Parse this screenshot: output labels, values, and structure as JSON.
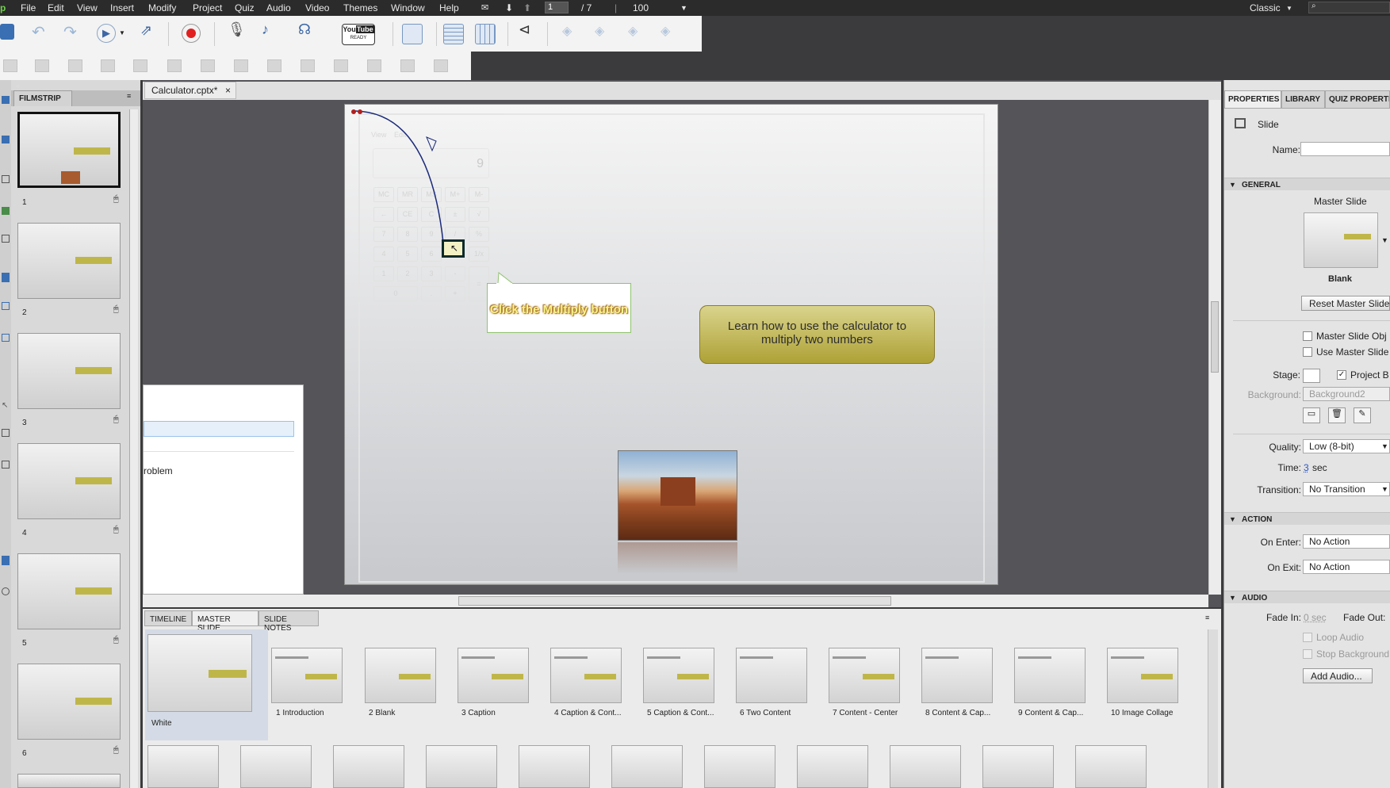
{
  "menubar": {
    "items": [
      "File",
      "Edit",
      "View",
      "Insert",
      "Modify",
      "Project",
      "Quiz",
      "Audio",
      "Video",
      "Themes",
      "Window",
      "Help"
    ],
    "current_slide": "1",
    "total_slides": "/ 7",
    "zoom": "100",
    "workspace": "Classic"
  },
  "toolbar": {
    "youtube_line1": "You",
    "youtube_line2": "Tube",
    "youtube_line3": "READY"
  },
  "filmstrip": {
    "title": "FILMSTRIP",
    "slides": [
      "1",
      "2",
      "3",
      "4",
      "5",
      "6"
    ]
  },
  "document": {
    "tab_title": "Calculator.cptx*",
    "tab_close": "×"
  },
  "slide": {
    "calc_menu_view": "View",
    "calc_menu_edit": "Edit",
    "calc_display": "9",
    "caption_text": "Click the Multiply button",
    "learn_text_line1": "Learn how to use the calculator to",
    "learn_text_line2": "multiply two numbers",
    "overlay_text": "roblem"
  },
  "bottom_panel": {
    "tabs": [
      "TIMELINE",
      "MASTER SLIDE",
      "SLIDE NOTES"
    ],
    "master_main_label": "White",
    "masters": [
      "1 Introduction",
      "2 Blank",
      "3 Caption",
      "4 Caption & Cont...",
      "5 Caption & Cont...",
      "6 Two Content",
      "7 Content - Center",
      "8 Content & Cap...",
      "9 Content & Cap...",
      "10 Image Collage"
    ]
  },
  "properties": {
    "tabs": [
      "PROPERTIES",
      "LIBRARY",
      "QUIZ PROPERTI"
    ],
    "object_type": "Slide",
    "name_label": "Name:",
    "name_value": "",
    "general_section": "GENERAL",
    "master_slide_label": "Master Slide",
    "master_name": "Blank",
    "reset_button": "Reset Master Slide",
    "master_slide_obj": "Master Slide Obj",
    "use_master_slide": "Use Master Slide",
    "stage_label": "Stage:",
    "project_bg": "Project B",
    "background_label": "Background:",
    "background_value": "Background2",
    "quality_label": "Quality:",
    "quality_value": "Low (8-bit)",
    "time_label": "Time:",
    "time_value": "3",
    "time_unit": "sec",
    "transition_label": "Transition:",
    "transition_value": "No Transition",
    "action_section": "ACTION",
    "on_enter_label": "On Enter:",
    "on_enter_value": "No Action",
    "on_exit_label": "On Exit:",
    "on_exit_value": "No Action",
    "audio_section": "AUDIO",
    "fade_in_label": "Fade In:",
    "fade_in_value": "0 sec",
    "fade_out_label": "Fade Out:",
    "loop_audio": "Loop Audio",
    "stop_background": "Stop Background",
    "add_audio_button": "Add Audio..."
  },
  "colors": {
    "accent_caption_border": "#8fc36f",
    "learn_box": "#bfb64a",
    "record_red": "#e02020"
  }
}
